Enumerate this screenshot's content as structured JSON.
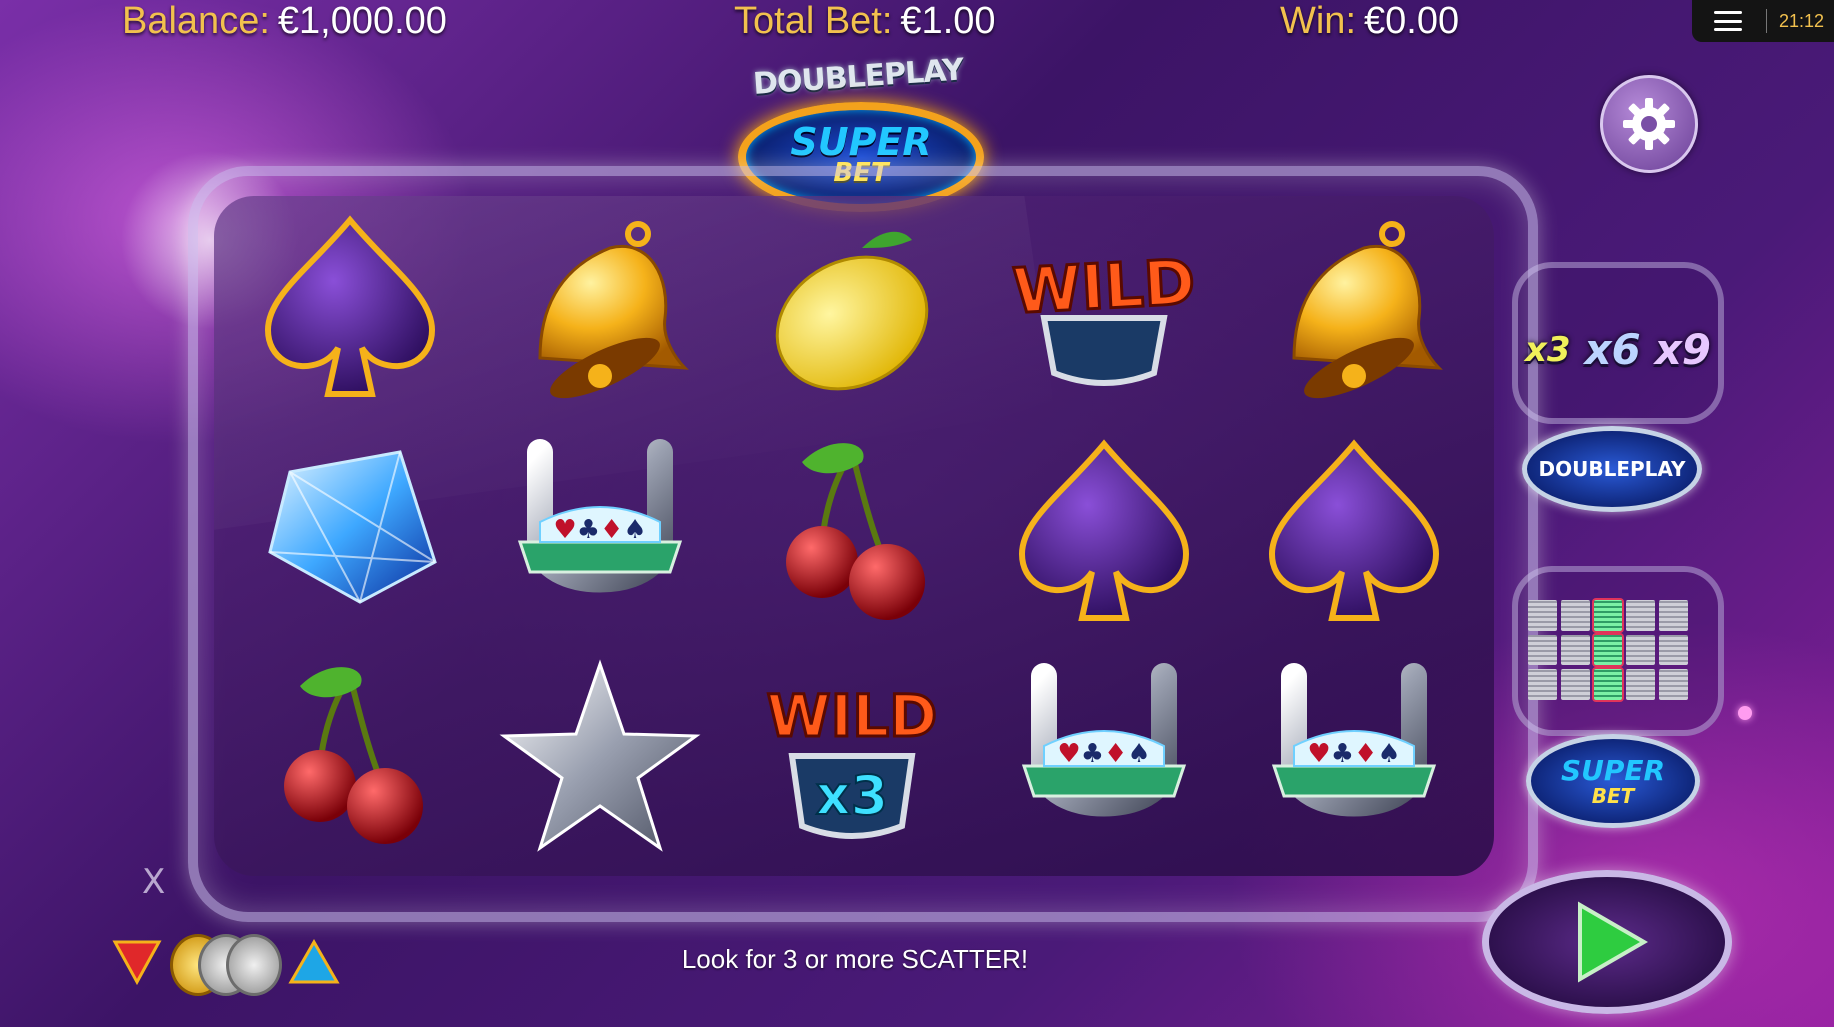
{
  "hud": {
    "balance_label": "Balance:",
    "balance_value": "€1,000.00",
    "total_bet_label": "Total Bet:",
    "total_bet_value": "€1.00",
    "win_label": "Win:",
    "win_value": "€0.00"
  },
  "system_bar": {
    "menu_icon": "hamburger-menu-icon",
    "clock": "21:12"
  },
  "logo": {
    "line1": "DOUBLEPLAY",
    "line2": "SUPER",
    "line3": "BET"
  },
  "reels": [
    [
      "spade",
      "bell",
      "lemon",
      "wild",
      "bell"
    ],
    [
      "diamond",
      "horseshoe",
      "cherry",
      "spade",
      "spade"
    ],
    [
      "cherry",
      "star",
      "wild-x3",
      "horseshoe",
      "horseshoe"
    ]
  ],
  "wild_text": "WILD",
  "wild_multiplier": "x3",
  "side_panel": {
    "multipliers": [
      "x3",
      "x6",
      "x9"
    ],
    "doubleplay_button": "DOUBLEPLAY",
    "superbet_line1": "SUPER",
    "superbet_line2": "BET",
    "paylines_icon": "paylines-grid-icon"
  },
  "controls": {
    "close_label": "X",
    "bet_decrease_icon": "triangle-down-icon",
    "bet_increase_icon": "triangle-up-icon",
    "coins_icon": "coin-stack-icon",
    "spin_icon": "play-icon"
  },
  "message": "Look for 3 or more SCATTER!",
  "colors": {
    "hud_label": "#f2c14e",
    "hud_value": "#ffffff",
    "background_primary": "#3c1466",
    "spin_arrow": "#2ecc40"
  }
}
